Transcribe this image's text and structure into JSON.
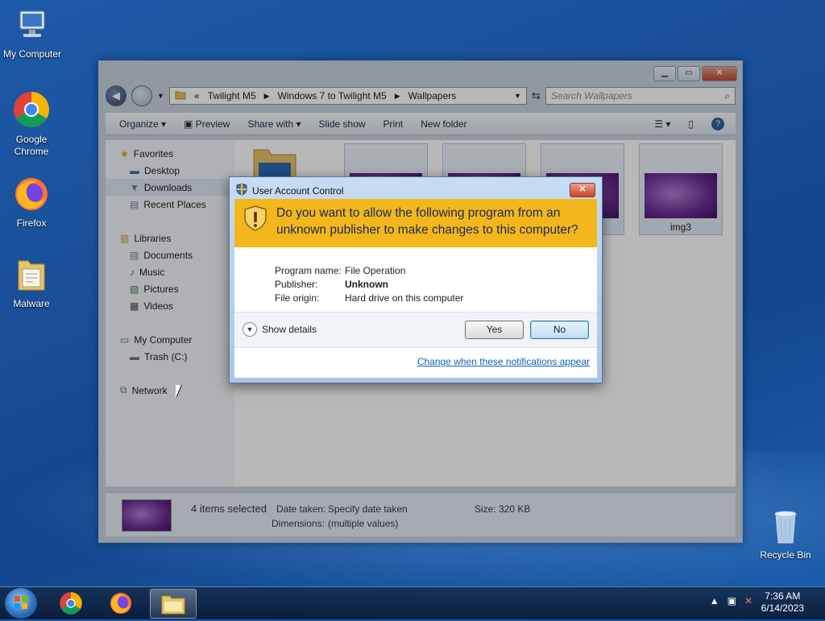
{
  "desktop": {
    "icons": [
      {
        "label": "My Computer",
        "icon": "computer-icon"
      },
      {
        "label": "Google Chrome",
        "icon": "chrome-icon"
      },
      {
        "label": "Firefox",
        "icon": "firefox-icon"
      },
      {
        "label": "Malware",
        "icon": "folder-icon"
      },
      {
        "label": "Recycle Bin",
        "icon": "recycle-bin-icon"
      }
    ]
  },
  "explorer": {
    "breadcrumb": [
      "Twilight M5",
      "Windows 7 to Twilight M5",
      "Wallpapers"
    ],
    "breadcrumb_prefix": "«",
    "search_placeholder": "Search Wallpapers",
    "toolbar": {
      "organize": "Organize ▾",
      "preview": "Preview",
      "share_with": "Share with ▾",
      "slide_show": "Slide show",
      "print": "Print",
      "new_folder": "New folder"
    },
    "nav": {
      "favorites": "Favorites",
      "desktop": "Desktop",
      "downloads": "Downloads",
      "recent_places": "Recent Places",
      "libraries": "Libraries",
      "documents": "Documents",
      "music": "Music",
      "pictures": "Pictures",
      "videos": "Videos",
      "my_computer": "My Computer",
      "trash": "Trash (C:)",
      "network": "Network"
    },
    "thumb_label": "img3",
    "status": {
      "count": "4 items selected",
      "date_taken_label": "Date taken:",
      "date_taken_value": "Specify date taken",
      "dimensions_label": "Dimensions:",
      "dimensions_value": "(multiple values)",
      "size_label": "Size:",
      "size_value": "320 KB"
    }
  },
  "uac": {
    "title": "User Account Control",
    "question": "Do you want to allow the following program from an unknown publisher to make changes to this computer?",
    "program_label": "Program name:",
    "program_value": "File Operation",
    "publisher_label": "Publisher:",
    "publisher_value": "Unknown",
    "origin_label": "File origin:",
    "origin_value": "Hard drive on this computer",
    "show_details": "Show details",
    "yes": "Yes",
    "no": "No",
    "link": "Change when these notifications appear"
  },
  "taskbar": {
    "time": "7:36 AM",
    "date": "6/14/2023"
  },
  "colors": {
    "uac_banner": "#f3b71d",
    "link": "#0f5fbd"
  }
}
